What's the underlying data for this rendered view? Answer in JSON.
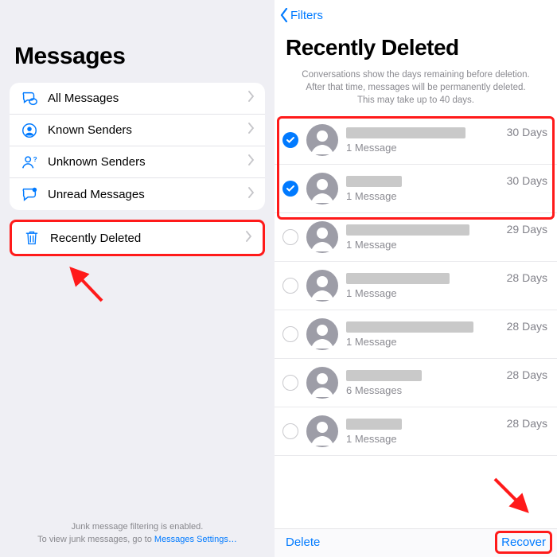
{
  "leftPane": {
    "title": "Messages",
    "filters": [
      {
        "label": "All Messages",
        "iconColor": "#007aff"
      },
      {
        "label": "Known Senders",
        "iconColor": "#007aff"
      },
      {
        "label": "Unknown Senders",
        "iconColor": "#007aff"
      },
      {
        "label": "Unread Messages",
        "iconColor": "#007aff"
      }
    ],
    "recentlyDeleted": {
      "label": "Recently Deleted"
    },
    "junkNote1": "Junk message filtering is enabled.",
    "junkNote2": "To view junk messages, go to ",
    "junkLink": "Messages Settings…"
  },
  "rightPane": {
    "backLabel": "Filters",
    "title": "Recently Deleted",
    "sub1": "Conversations show the days remaining before deletion.",
    "sub2": "After that time, messages will be permanently deleted.",
    "sub3": "This may take up to 40 days.",
    "items": [
      {
        "selected": true,
        "redactW": 150,
        "count": "1 Message",
        "days": "30 Days"
      },
      {
        "selected": true,
        "redactW": 70,
        "count": "1 Message",
        "days": "30 Days"
      },
      {
        "selected": false,
        "redactW": 155,
        "count": "1 Message",
        "days": "29 Days"
      },
      {
        "selected": false,
        "redactW": 130,
        "count": "1 Message",
        "days": "28 Days"
      },
      {
        "selected": false,
        "redactW": 160,
        "count": "1 Message",
        "days": "28 Days"
      },
      {
        "selected": false,
        "redactW": 95,
        "count": "6 Messages",
        "days": "28 Days"
      },
      {
        "selected": false,
        "redactW": 70,
        "count": "1 Message",
        "days": "28 Days"
      }
    ],
    "deleteLabel": "Delete",
    "recoverLabel": "Recover"
  }
}
